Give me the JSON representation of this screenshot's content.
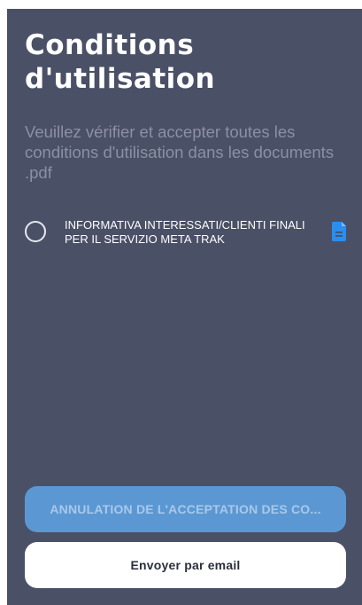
{
  "page": {
    "title_line1": "Conditions",
    "title_line2": "d'utilisation",
    "subtitle": "Veuillez vérifier et accepter toutes les conditions d'utilisation dans les documents .pdf"
  },
  "documents": [
    {
      "name": "INFORMATIVA INTERESSATI/CLIENTI FINALI PER IL SERVIZIO META TRAK",
      "accepted": false,
      "icon": "document-icon"
    }
  ],
  "actions": {
    "cancel_label": "ANNULATION DE L'ACCEPTATION DES CO...",
    "email_label": "Envoyer par email"
  },
  "colors": {
    "background": "#4a5066",
    "accent_blue": "#2a8ef0",
    "cancel_button": "#5b98d3",
    "cancel_text": "#a9c8ea",
    "email_button": "#ffffff"
  }
}
